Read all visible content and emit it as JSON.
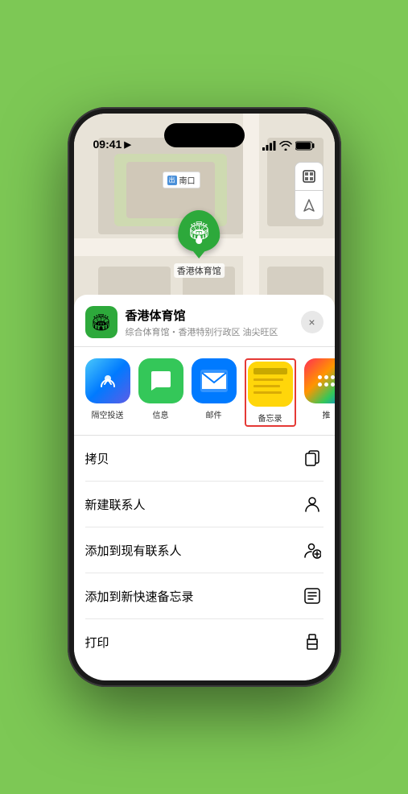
{
  "status_bar": {
    "time": "09:41",
    "location_icon": "▶"
  },
  "map": {
    "label_text": "南口",
    "marker_name": "香港体育馆",
    "controls": [
      "map-layers",
      "location"
    ]
  },
  "sheet": {
    "venue_name": "香港体育馆",
    "venue_subtitle": "综合体育馆・香港特别行政区 油尖旺区",
    "close_label": "×"
  },
  "share_apps": [
    {
      "id": "airdrop",
      "label": "隔空投送",
      "type": "airdrop"
    },
    {
      "id": "messages",
      "label": "信息",
      "type": "messages"
    },
    {
      "id": "mail",
      "label": "邮件",
      "type": "mail"
    },
    {
      "id": "notes",
      "label": "备忘录",
      "type": "notes"
    },
    {
      "id": "more",
      "label": "推",
      "type": "more"
    }
  ],
  "actions": [
    {
      "id": "copy",
      "label": "拷贝",
      "icon": "copy"
    },
    {
      "id": "new-contact",
      "label": "新建联系人",
      "icon": "person"
    },
    {
      "id": "add-contact",
      "label": "添加到现有联系人",
      "icon": "person-add"
    },
    {
      "id": "quick-note",
      "label": "添加到新快速备忘录",
      "icon": "note"
    },
    {
      "id": "print",
      "label": "打印",
      "icon": "printer"
    }
  ]
}
